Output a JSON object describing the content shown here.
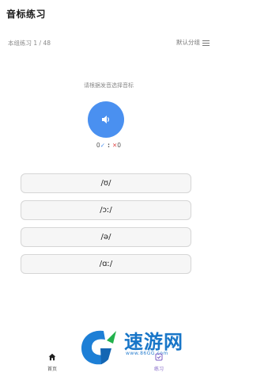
{
  "header": {
    "title": "音标练习"
  },
  "progress": {
    "label": "本组练习 1 / 48",
    "group_setting_label": "默认分组"
  },
  "quiz": {
    "prompt": "请根据发音选择音标",
    "correct_count": "0",
    "separator": ":",
    "wrong_count": "0",
    "options": [
      "/ʊ/",
      "/ɔː/",
      "/ə/",
      "/ɑː/"
    ]
  },
  "bottom_nav": {
    "home_label": "首页",
    "practice_label": "练习"
  },
  "watermark": {
    "brand": "速游网",
    "url": "www.86GG.com"
  },
  "colors": {
    "accent": "#4a90f0",
    "wrong": "#e05050",
    "active_tab": "#7b5cc4"
  },
  "icons": {
    "speaker": "speaker-icon",
    "menu": "menu-icon",
    "home": "home-icon",
    "practice": "practice-icon"
  }
}
